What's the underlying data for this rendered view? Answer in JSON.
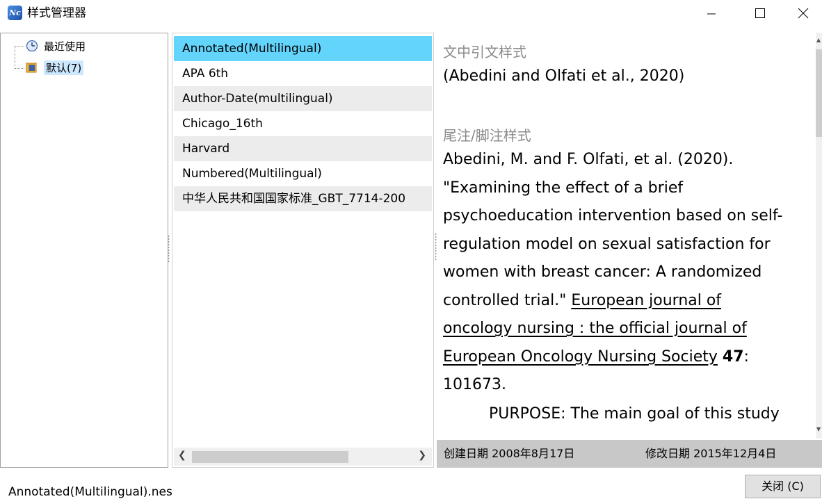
{
  "window": {
    "title": "样式管理器",
    "icon": "nc-app-icon"
  },
  "tree": {
    "items": [
      {
        "label": "最近使用",
        "icon": "clock-icon"
      },
      {
        "label": "默认(7)",
        "icon": "folder-book-icon",
        "selected": true
      }
    ]
  },
  "styles": {
    "items": [
      {
        "label": "Annotated(Multilingual)",
        "selected": true
      },
      {
        "label": "APA 6th"
      },
      {
        "label": "Author-Date(multilingual)"
      },
      {
        "label": "Chicago_16th"
      },
      {
        "label": "Harvard"
      },
      {
        "label": "Numbered(Multilingual)"
      },
      {
        "label": "中华人民共和国国家标准_GBT_7714-200"
      }
    ]
  },
  "preview": {
    "intext_heading": "文中引文样式",
    "intext_citation": "(Abedini and Olfati et al., 2020)",
    "note_heading": "尾注/脚注样式",
    "lines": {
      "l1": "Abedini, M. and F. Olfati, et al. (2020).",
      "l2": "\"Examining the effect of a brief",
      "l3": "psychoeducation intervention based on self-",
      "l4": "regulation model on sexual satisfaction for",
      "l5": "women with breast cancer: A randomized",
      "l6a": "controlled trial.\" ",
      "l6b": "European journal of ",
      "l7": "oncology nursing : the official journal of ",
      "l8a": "European Oncology Nursing Society",
      "l8b": " ",
      "l8c": "47",
      "l8d": ":",
      "l9": "101673.",
      "l10": "PURPOSE: The main goal of this study"
    },
    "created_label": "创建日期  2008年8月17日",
    "modified_label": "修改日期  2015年12月4日"
  },
  "status": {
    "filename": "Annotated(Multilingual).nes"
  },
  "buttons": {
    "close": "关闭 (C)"
  },
  "colors": {
    "selected_row": "#63d4fb",
    "alt_row": "#ececec",
    "tree_selected": "#cce8ff",
    "date_bar": "#c8c8c8"
  }
}
